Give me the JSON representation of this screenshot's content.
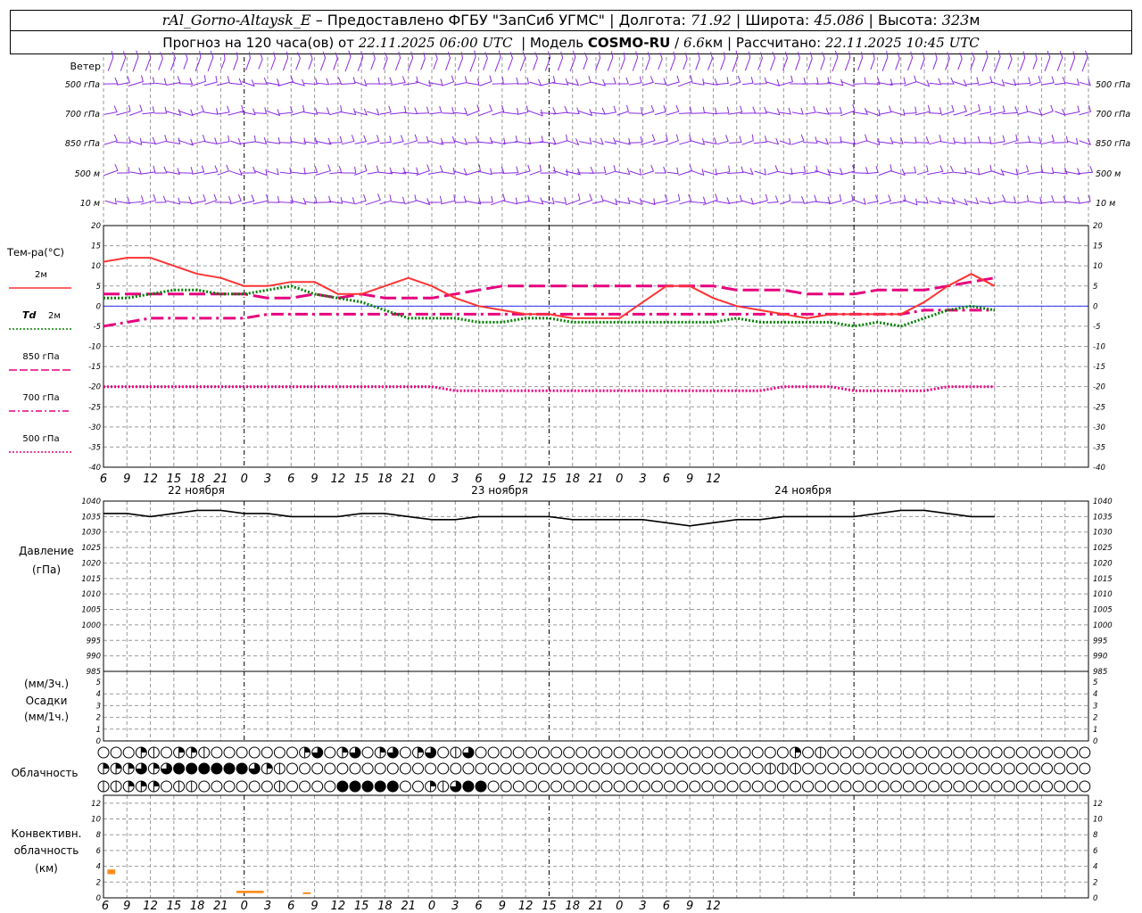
{
  "header": {
    "station": "rAl_Gorno-Altaysk_E",
    "dash": "–",
    "provider": "Предоставлено ФГБУ \"ЗапСиб УГМС\"",
    "sep": "|",
    "lon_label": "Долгота:",
    "lon": "71.92",
    "lat_label": "Широта:",
    "lat": "45.086",
    "alt_label": "Высота:",
    "alt": "323",
    "alt_unit": "м",
    "forecast_prefix": "Прогноз на 120 часа(ов) от",
    "forecast_start": "22.11.2025 06:00 UTC",
    "model_label": "Модель",
    "model": "COSMO-RU",
    "slash": "/",
    "res": "6.6",
    "res_unit": "км",
    "calc_label": "Рассчитано:",
    "calc_time": "22.11.2025 10:45 UTC"
  },
  "panels": {
    "wind": {
      "title": "Ветер",
      "levels": [
        "500 гПа",
        "700 гПа",
        "850 гПа",
        "500 м",
        "10 м"
      ],
      "color": "#8a2be2"
    },
    "temp": {
      "title": "Тем-ра(°С)",
      "legend": [
        {
          "label": "2м",
          "color": "#ff3333",
          "dash": "solid"
        },
        {
          "label": "Td",
          "label2": "2м",
          "color": "#008000",
          "dash": "dot"
        },
        {
          "label": "850 гПа",
          "color": "#e6007e",
          "dash": "longdash"
        },
        {
          "label": "700 гПа",
          "color": "#e6007e",
          "dash": "dashdot"
        },
        {
          "label": "500 гПа",
          "color": "#e6007e",
          "dash": "dense"
        }
      ],
      "yticks": [
        "20",
        "15",
        "10",
        "5",
        "0",
        "-5",
        "-10",
        "-15",
        "-20",
        "-25",
        "-30",
        "-35",
        "-40"
      ]
    },
    "pressure": {
      "title": "Давление",
      "unit": "(гПа)",
      "yticks": [
        "1040",
        "1035",
        "1030",
        "1025",
        "1020",
        "1015",
        "1010",
        "1005",
        "1000",
        "995",
        "990",
        "985"
      ]
    },
    "precip": {
      "unit1": "(мм/3ч.)",
      "title": "Осадки",
      "unit2": "(мм/1ч.)",
      "yticks": [
        "5",
        "4",
        "3",
        "2",
        "1",
        "0"
      ]
    },
    "cloud": {
      "title": "Облачность"
    },
    "conv": {
      "title1": "Конвективн.",
      "title2": "облачность",
      "unit": "(км)",
      "yticks": [
        "12",
        "10",
        "8",
        "6",
        "4",
        "2",
        "0"
      ]
    }
  },
  "xaxis": {
    "hour_labels": [
      "6",
      "9",
      "12",
      "15",
      "18",
      "21",
      "0",
      "3",
      "6",
      "9",
      "12",
      "15",
      "18",
      "21",
      "0",
      "3",
      "6",
      "9",
      "12",
      "15",
      "18",
      "21",
      "0",
      "3",
      "6",
      "9",
      "12"
    ],
    "day_labels": [
      "22 ноября",
      "23 ноября",
      "24 ноября"
    ]
  },
  "chart_data": [
    {
      "type": "line",
      "title": "Тем-ра(°С)",
      "x_hours_from_start": [
        0,
        3,
        6,
        9,
        12,
        15,
        18,
        21,
        24,
        27,
        30,
        33,
        36,
        39,
        42,
        45,
        48,
        51,
        54,
        57,
        60,
        63,
        66,
        69,
        72,
        75,
        78,
        81,
        84,
        87,
        90,
        93,
        96,
        99,
        102,
        105,
        108,
        111,
        114
      ],
      "ylim": [
        -40,
        20
      ],
      "series": [
        {
          "name": "2м",
          "values": [
            11,
            12,
            12,
            10,
            8,
            7,
            5,
            5,
            6,
            6,
            3,
            3,
            5,
            7,
            5,
            2,
            0,
            -1,
            -2,
            -2,
            -3,
            -3,
            -3,
            1,
            5,
            5,
            2,
            0,
            -1,
            -2,
            -3,
            -2,
            -2,
            -2,
            -2,
            1,
            5,
            8,
            5
          ]
        },
        {
          "name": "Td 2м",
          "values": [
            2,
            2,
            3,
            4,
            4,
            3,
            3,
            4,
            5,
            3,
            2,
            1,
            -1,
            -3,
            -3,
            -3,
            -4,
            -4,
            -3,
            -3,
            -4,
            -4,
            -4,
            -4,
            -4,
            -4,
            -4,
            -3,
            -4,
            -4,
            -4,
            -4,
            -5,
            -4,
            -5,
            -3,
            -1,
            0,
            -1
          ]
        },
        {
          "name": "850 гПа",
          "values": [
            3,
            3,
            3,
            3,
            3,
            3,
            3,
            2,
            2,
            3,
            2,
            3,
            2,
            2,
            2,
            3,
            4,
            5,
            5,
            5,
            5,
            5,
            5,
            5,
            5,
            5,
            5,
            4,
            4,
            4,
            3,
            3,
            3,
            4,
            4,
            4,
            5,
            6,
            7
          ]
        },
        {
          "name": "700 гПа",
          "values": [
            -5,
            -4,
            -3,
            -3,
            -3,
            -3,
            -3,
            -2,
            -2,
            -2,
            -2,
            -2,
            -2,
            -2,
            -2,
            -2,
            -2,
            -2,
            -2,
            -2,
            -2,
            -2,
            -2,
            -2,
            -2,
            -2,
            -2,
            -2,
            -2,
            -2,
            -2,
            -2,
            -2,
            -2,
            -2,
            -1,
            -1,
            -1,
            -1
          ]
        },
        {
          "name": "500 гПа",
          "values": [
            -20,
            -20,
            -20,
            -20,
            -20,
            -20,
            -20,
            -20,
            -20,
            -20,
            -20,
            -20,
            -20,
            -20,
            -20,
            -21,
            -21,
            -21,
            -21,
            -21,
            -21,
            -21,
            -21,
            -21,
            -21,
            -21,
            -21,
            -21,
            -21,
            -20,
            -20,
            -20,
            -21,
            -21,
            -21,
            -21,
            -20,
            -20,
            -20
          ]
        }
      ]
    },
    {
      "type": "line",
      "title": "Давление",
      "ylabel": "(гПа)",
      "ylim": [
        985,
        1040
      ],
      "x_hours_from_start": [
        0,
        3,
        6,
        9,
        12,
        15,
        18,
        21,
        24,
        27,
        30,
        33,
        36,
        39,
        42,
        45,
        48,
        51,
        54,
        57,
        60,
        63,
        66,
        69,
        72,
        75,
        78,
        81,
        84,
        87,
        90,
        93,
        96,
        99,
        102,
        105,
        108,
        111,
        114
      ],
      "series": [
        {
          "name": "",
          "values": [
            1036,
            1036,
            1035,
            1036,
            1037,
            1037,
            1036,
            1036,
            1035,
            1035,
            1035,
            1036,
            1036,
            1035,
            1034,
            1034,
            1035,
            1035,
            1035,
            1035,
            1034,
            1034,
            1034,
            1034,
            1033,
            1032,
            1033,
            1034,
            1034,
            1035,
            1035,
            1035,
            1035,
            1036,
            1037,
            1037,
            1036,
            1035,
            1035
          ]
        }
      ]
    },
    {
      "type": "bar",
      "title": "Конвективн. облачность",
      "ylabel": "(км)",
      "ylim": [
        0,
        13
      ],
      "bars": [
        {
          "x_start": 0.5,
          "x_end": 1.5,
          "base": 3.0,
          "top": 3.6
        },
        {
          "x_start": 17.0,
          "x_end": 20.5,
          "base": 0.6,
          "top": 0.9
        },
        {
          "x_start": 25.5,
          "x_end": 26.5,
          "base": 0.6,
          "top": 0.7
        }
      ]
    }
  ],
  "cloud_rows": [
    [
      "0",
      "0",
      "0",
      "2",
      "1",
      "0",
      "2",
      "2",
      "1",
      "0",
      "0",
      "0",
      "0",
      "0",
      "0",
      "0",
      "2",
      "3",
      "0",
      "2",
      "3",
      "0",
      "2",
      "3",
      "0",
      "2",
      "3",
      "0",
      "1",
      "3",
      "0",
      "0",
      "0",
      "0",
      "0",
      "0",
      "0",
      "0",
      "0",
      "0",
      "0",
      "0",
      "0",
      "0",
      "0",
      "0",
      "0",
      "0",
      "0",
      "0",
      "0",
      "0",
      "0",
      "0",
      "0",
      "2",
      "0",
      "1",
      "0",
      "0",
      "0",
      "0",
      "0",
      "0",
      "0",
      "0",
      "0",
      "0",
      "0",
      "0",
      "0",
      "0",
      "0",
      "0",
      "0",
      "0",
      "0",
      "0",
      "0"
    ],
    [
      "2",
      "2",
      "2",
      "3",
      "2",
      "3",
      "4",
      "4",
      "4",
      "4",
      "4",
      "4",
      "3",
      "2",
      "1",
      "0",
      "0",
      "0",
      "0",
      "0",
      "0",
      "0",
      "0",
      "0",
      "0",
      "0",
      "0",
      "0",
      "0",
      "0",
      "0",
      "0",
      "0",
      "0",
      "0",
      "0",
      "0",
      "0",
      "0",
      "0",
      "0",
      "0",
      "0",
      "0",
      "0",
      "0",
      "0",
      "0",
      "0",
      "0",
      "0",
      "0",
      "0",
      "1",
      "1",
      "1",
      "0",
      "0",
      "0",
      "0",
      "0",
      "0",
      "0",
      "0",
      "0",
      "0",
      "0",
      "0",
      "0",
      "0",
      "0",
      "0",
      "0",
      "0",
      "0",
      "0",
      "0",
      "0",
      "0"
    ],
    [
      "1",
      "1",
      "2",
      "2",
      "2",
      "0",
      "1",
      "1",
      "0",
      "0",
      "0",
      "0",
      "0",
      "0",
      "1",
      "0",
      "0",
      "0",
      "0",
      "4",
      "4",
      "4",
      "4",
      "4",
      "0",
      "0",
      "2",
      "1",
      "3",
      "4",
      "4",
      "0",
      "0",
      "0",
      "0",
      "0",
      "0",
      "0",
      "0",
      "0",
      "0",
      "0",
      "0",
      "0",
      "0",
      "0",
      "0",
      "0",
      "0",
      "0",
      "0",
      "0",
      "0",
      "0",
      "0",
      "0",
      "0",
      "0",
      "0",
      "0",
      "0",
      "0",
      "0",
      "0",
      "0",
      "0",
      "0",
      "0",
      "0",
      "0",
      "0",
      "0",
      "0",
      "0",
      "0",
      "0",
      "0",
      "0",
      "0"
    ]
  ],
  "colors": {
    "grid": "#999999",
    "frame": "#000000",
    "wind": "#8a2be2",
    "t2m": "#ff3333",
    "td": "#008000",
    "upper": "#e6007e",
    "conv": "#ff8c1a",
    "zero_line": "#3333ff"
  }
}
